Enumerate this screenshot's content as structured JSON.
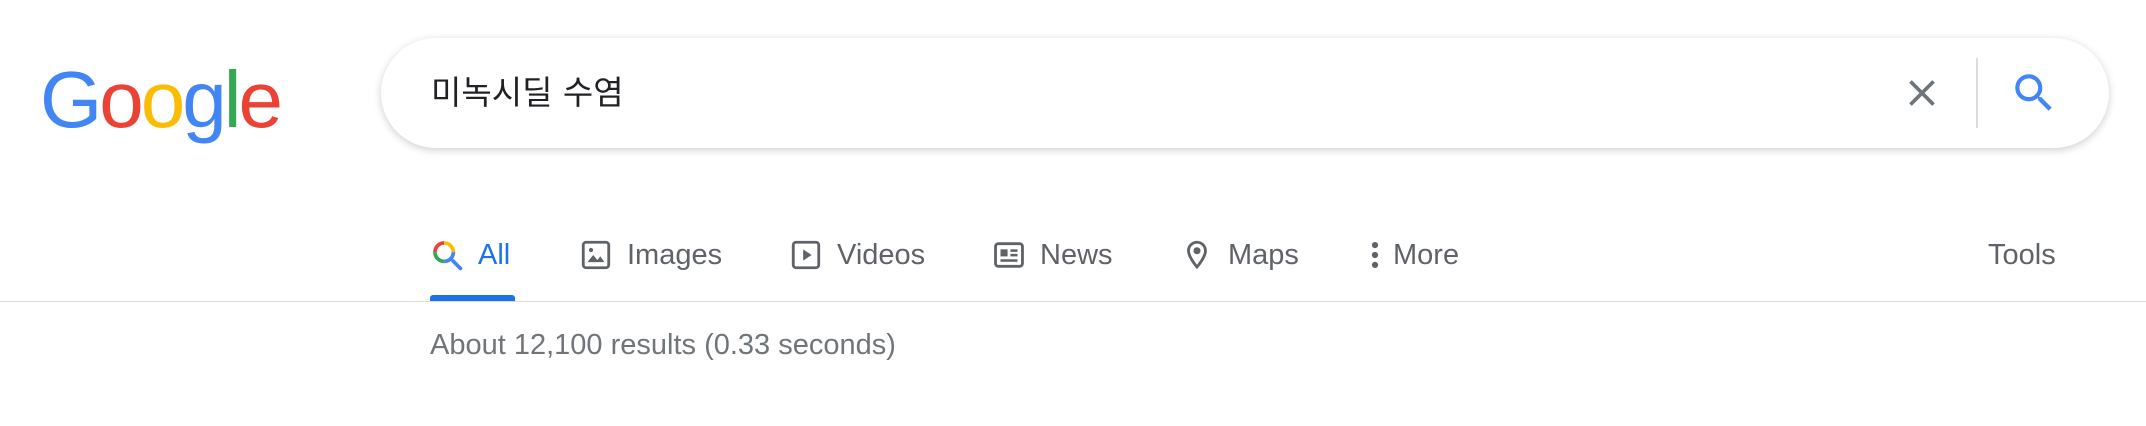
{
  "logo": {
    "letters": [
      "G",
      "o",
      "o",
      "g",
      "l",
      "e"
    ],
    "colors": [
      "#4285F4",
      "#EA4335",
      "#FBBC05",
      "#4285F4",
      "#34A853",
      "#EA4335"
    ]
  },
  "search": {
    "query": "미녹시딜 수염",
    "clear_icon": "close-icon",
    "search_icon": "search-icon",
    "accent": "#4285F4"
  },
  "tabs": [
    {
      "label": "All",
      "icon": "search-multicolor-icon",
      "active": true
    },
    {
      "label": "Images",
      "icon": "image-icon",
      "active": false
    },
    {
      "label": "Videos",
      "icon": "play-icon",
      "active": false
    },
    {
      "label": "News",
      "icon": "news-icon",
      "active": false
    },
    {
      "label": "Maps",
      "icon": "map-pin-icon",
      "active": false
    },
    {
      "label": "More",
      "icon": "more-vert-icon",
      "active": false
    }
  ],
  "tools_label": "Tools",
  "result_stats": "About 12,100 results (0.33 seconds)",
  "colors": {
    "active_tab": "#1a73e8",
    "inactive_tab": "#5f6368",
    "stats_text": "#70757a"
  }
}
